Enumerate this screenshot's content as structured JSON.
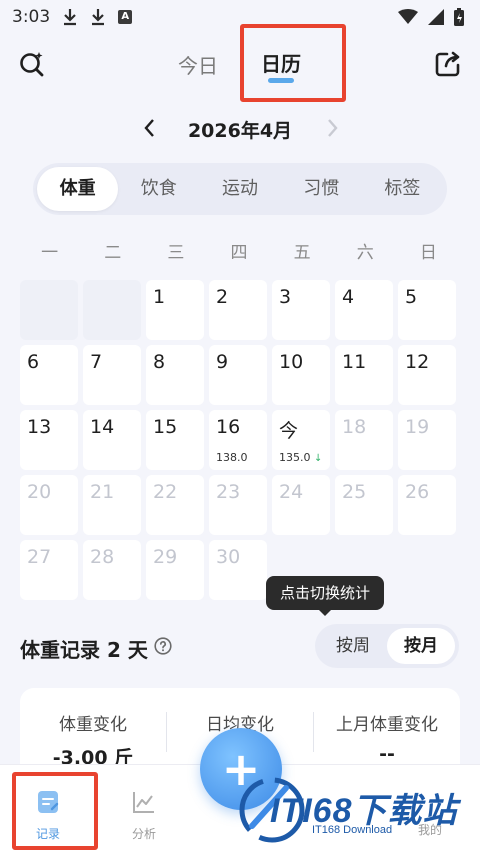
{
  "status_bar": {
    "time": "3:03"
  },
  "header": {
    "tab_today": "今日",
    "tab_calendar": "日历",
    "search_icon": "search-sparkle-icon",
    "share_icon": "share-out-icon"
  },
  "month_nav": {
    "title": "2026年4月"
  },
  "categories": [
    "体重",
    "饮食",
    "运动",
    "习惯",
    "标签"
  ],
  "weekdays": [
    "一",
    "二",
    "三",
    "四",
    "五",
    "六",
    "日"
  ],
  "calendar": {
    "cells": [
      {
        "label": "",
        "sub": ""
      },
      {
        "label": "",
        "sub": ""
      },
      {
        "label": "1",
        "sub": ""
      },
      {
        "label": "2",
        "sub": ""
      },
      {
        "label": "3",
        "sub": ""
      },
      {
        "label": "4",
        "sub": ""
      },
      {
        "label": "5",
        "sub": ""
      },
      {
        "label": "6",
        "sub": ""
      },
      {
        "label": "7",
        "sub": ""
      },
      {
        "label": "8",
        "sub": ""
      },
      {
        "label": "9",
        "sub": ""
      },
      {
        "label": "10",
        "sub": ""
      },
      {
        "label": "11",
        "sub": ""
      },
      {
        "label": "12",
        "sub": ""
      },
      {
        "label": "13",
        "sub": ""
      },
      {
        "label": "14",
        "sub": ""
      },
      {
        "label": "15",
        "sub": ""
      },
      {
        "label": "16",
        "sub": "138.0"
      },
      {
        "label": "今",
        "sub": "135.0"
      },
      {
        "label": "18",
        "sub": ""
      },
      {
        "label": "19",
        "sub": ""
      },
      {
        "label": "20",
        "sub": ""
      },
      {
        "label": "21",
        "sub": ""
      },
      {
        "label": "22",
        "sub": ""
      },
      {
        "label": "23",
        "sub": ""
      },
      {
        "label": "24",
        "sub": ""
      },
      {
        "label": "25",
        "sub": ""
      },
      {
        "label": "26",
        "sub": ""
      },
      {
        "label": "27",
        "sub": ""
      },
      {
        "label": "28",
        "sub": ""
      },
      {
        "label": "29",
        "sub": ""
      },
      {
        "label": "30",
        "sub": ""
      }
    ]
  },
  "tooltip": "点击切换统计",
  "records": {
    "title": "体重记录 2 天",
    "toggle_week": "按周",
    "toggle_month": "按月"
  },
  "stats": [
    {
      "label": "体重变化",
      "value": "-3.00 斤"
    },
    {
      "label": "日均变化",
      "value": ""
    },
    {
      "label": "上月体重变化",
      "value": "--"
    }
  ],
  "bottom_nav": [
    {
      "label": "记录"
    },
    {
      "label": "分析"
    },
    {
      "label": "我的"
    }
  ],
  "watermark": {
    "brand": "ITI68下载站",
    "sub": "IT168 Download"
  },
  "colors": {
    "accent": "#5aa8ea",
    "highlight": "#e8432f",
    "weight_down": "#34b36b"
  }
}
